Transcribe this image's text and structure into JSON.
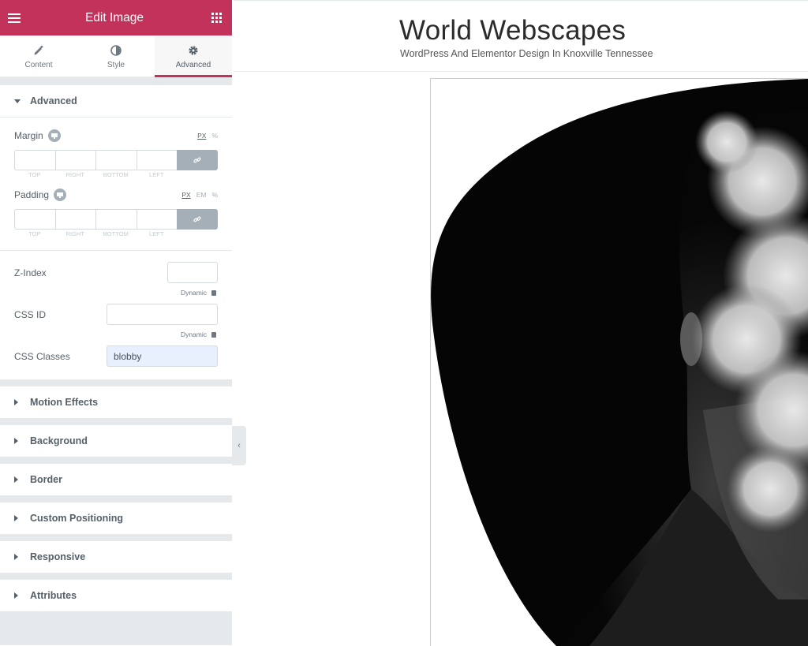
{
  "panel": {
    "title": "Edit Image",
    "tabs": [
      {
        "label": "Content",
        "icon": "pencil-icon"
      },
      {
        "label": "Style",
        "icon": "half-circle-icon"
      },
      {
        "label": "Advanced",
        "icon": "gear-icon"
      }
    ],
    "active_tab": "Advanced",
    "accent_color": "#c2325a"
  },
  "advanced": {
    "heading": "Advanced",
    "margin": {
      "label": "Margin",
      "units": [
        "PX",
        "%"
      ],
      "selected_unit": "PX",
      "fields": [
        "TOP",
        "RIGHT",
        "BOTTOM",
        "LEFT"
      ]
    },
    "padding": {
      "label": "Padding",
      "units": [
        "PX",
        "EM",
        "%"
      ],
      "selected_unit": "PX",
      "fields": [
        "TOP",
        "RIGHT",
        "BOTTOM",
        "LEFT"
      ]
    },
    "z_index": {
      "label": "Z-Index",
      "value": ""
    },
    "dynamic_label": "Dynamic",
    "css_id": {
      "label": "CSS ID",
      "value": ""
    },
    "css_classes": {
      "label": "CSS Classes",
      "value": "blobby"
    }
  },
  "sections": [
    "Motion Effects",
    "Background",
    "Border",
    "Custom Positioning",
    "Responsive",
    "Attributes"
  ],
  "site": {
    "title": "World Webscapes",
    "tagline": "WordPress And Elementor Design In Knoxville Tennessee"
  }
}
